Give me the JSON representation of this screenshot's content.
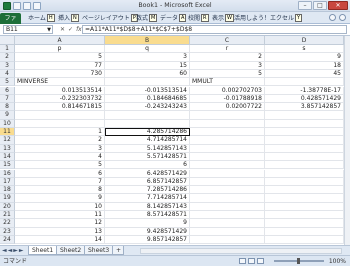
{
  "window": {
    "title": "Book1 - Microsoft Excel",
    "minimize": "–",
    "maximize": "□",
    "close": "✕"
  },
  "ribbon": {
    "tabs": [
      {
        "label": "ファイル",
        "key": "F"
      },
      {
        "label": "ホーム",
        "key": "H"
      },
      {
        "label": "挿入",
        "key": "N"
      },
      {
        "label": "ページレイアウト",
        "key": "P"
      },
      {
        "label": "数式",
        "key": "M"
      },
      {
        "label": "データ",
        "key": "A"
      },
      {
        "label": "校閲",
        "key": "R"
      },
      {
        "label": "表示",
        "key": "W"
      },
      {
        "label": "活用しよう！エクセル",
        "key": "Y"
      }
    ]
  },
  "formula_bar": {
    "name_box": "B11",
    "fx_label": "fx",
    "formula": "=A11*A11*$D$8+A11*$C$7+$D$8"
  },
  "columns": [
    "A",
    "B",
    "C",
    "D"
  ],
  "rows": [
    {
      "num": "1",
      "A": "p",
      "B": "q",
      "C": "r",
      "D": "s",
      "align": "header"
    },
    {
      "num": "2",
      "A": "5",
      "B": "3",
      "C": "2",
      "D": "9"
    },
    {
      "num": "3",
      "A": "77",
      "B": "15",
      "C": "3",
      "D": "18"
    },
    {
      "num": "4",
      "A": "730",
      "B": "60",
      "C": "5",
      "D": "45"
    },
    {
      "num": "5",
      "A": "MINVERSE",
      "B": "",
      "C": "MMULT",
      "D": "",
      "textrow": true
    },
    {
      "num": "6",
      "A": "0.013513514",
      "B": "-0.013513514",
      "C": "0.002702703",
      "D": "-1.38778E-17"
    },
    {
      "num": "7",
      "A": "-0.232303732",
      "B": "0.184684685",
      "C": "-0.01788918",
      "D": "0.428571429"
    },
    {
      "num": "8",
      "A": "0.814671815",
      "B": "-0.243243243",
      "C": "0.02007722",
      "D": "3.857142857"
    },
    {
      "num": "9",
      "A": "",
      "B": "",
      "C": "",
      "D": ""
    },
    {
      "num": "10",
      "A": "",
      "B": "",
      "C": "",
      "D": ""
    },
    {
      "num": "11",
      "A": "1",
      "B": "4.285714286",
      "C": "",
      "D": ""
    },
    {
      "num": "12",
      "A": "2",
      "B": "4.714285714",
      "C": "",
      "D": ""
    },
    {
      "num": "13",
      "A": "3",
      "B": "5.142857143",
      "C": "",
      "D": ""
    },
    {
      "num": "14",
      "A": "4",
      "B": "5.571428571",
      "C": "",
      "D": ""
    },
    {
      "num": "15",
      "A": "5",
      "B": "6",
      "C": "",
      "D": ""
    },
    {
      "num": "16",
      "A": "6",
      "B": "6.428571429",
      "C": "",
      "D": ""
    },
    {
      "num": "17",
      "A": "7",
      "B": "6.857142857",
      "C": "",
      "D": ""
    },
    {
      "num": "18",
      "A": "8",
      "B": "7.285714286",
      "C": "",
      "D": ""
    },
    {
      "num": "19",
      "A": "9",
      "B": "7.714285714",
      "C": "",
      "D": ""
    },
    {
      "num": "20",
      "A": "10",
      "B": "8.142857143",
      "C": "",
      "D": ""
    },
    {
      "num": "21",
      "A": "11",
      "B": "8.571428571",
      "C": "",
      "D": ""
    },
    {
      "num": "22",
      "A": "12",
      "B": "9",
      "C": "",
      "D": ""
    },
    {
      "num": "23",
      "A": "13",
      "B": "9.428571429",
      "C": "",
      "D": ""
    },
    {
      "num": "24",
      "A": "14",
      "B": "9.857142857",
      "C": "",
      "D": ""
    }
  ],
  "sheets": [
    "Sheet1",
    "Sheet2",
    "Sheet3"
  ],
  "active_sheet": "Sheet1",
  "status": {
    "mode": "コマンド",
    "zoom": "100%"
  },
  "active_cell": {
    "row": "11",
    "col": "B"
  },
  "colors": {
    "file_tab": "#1d6e38",
    "selected_header": "#f9dc8f",
    "close_button": "#c9473f"
  }
}
